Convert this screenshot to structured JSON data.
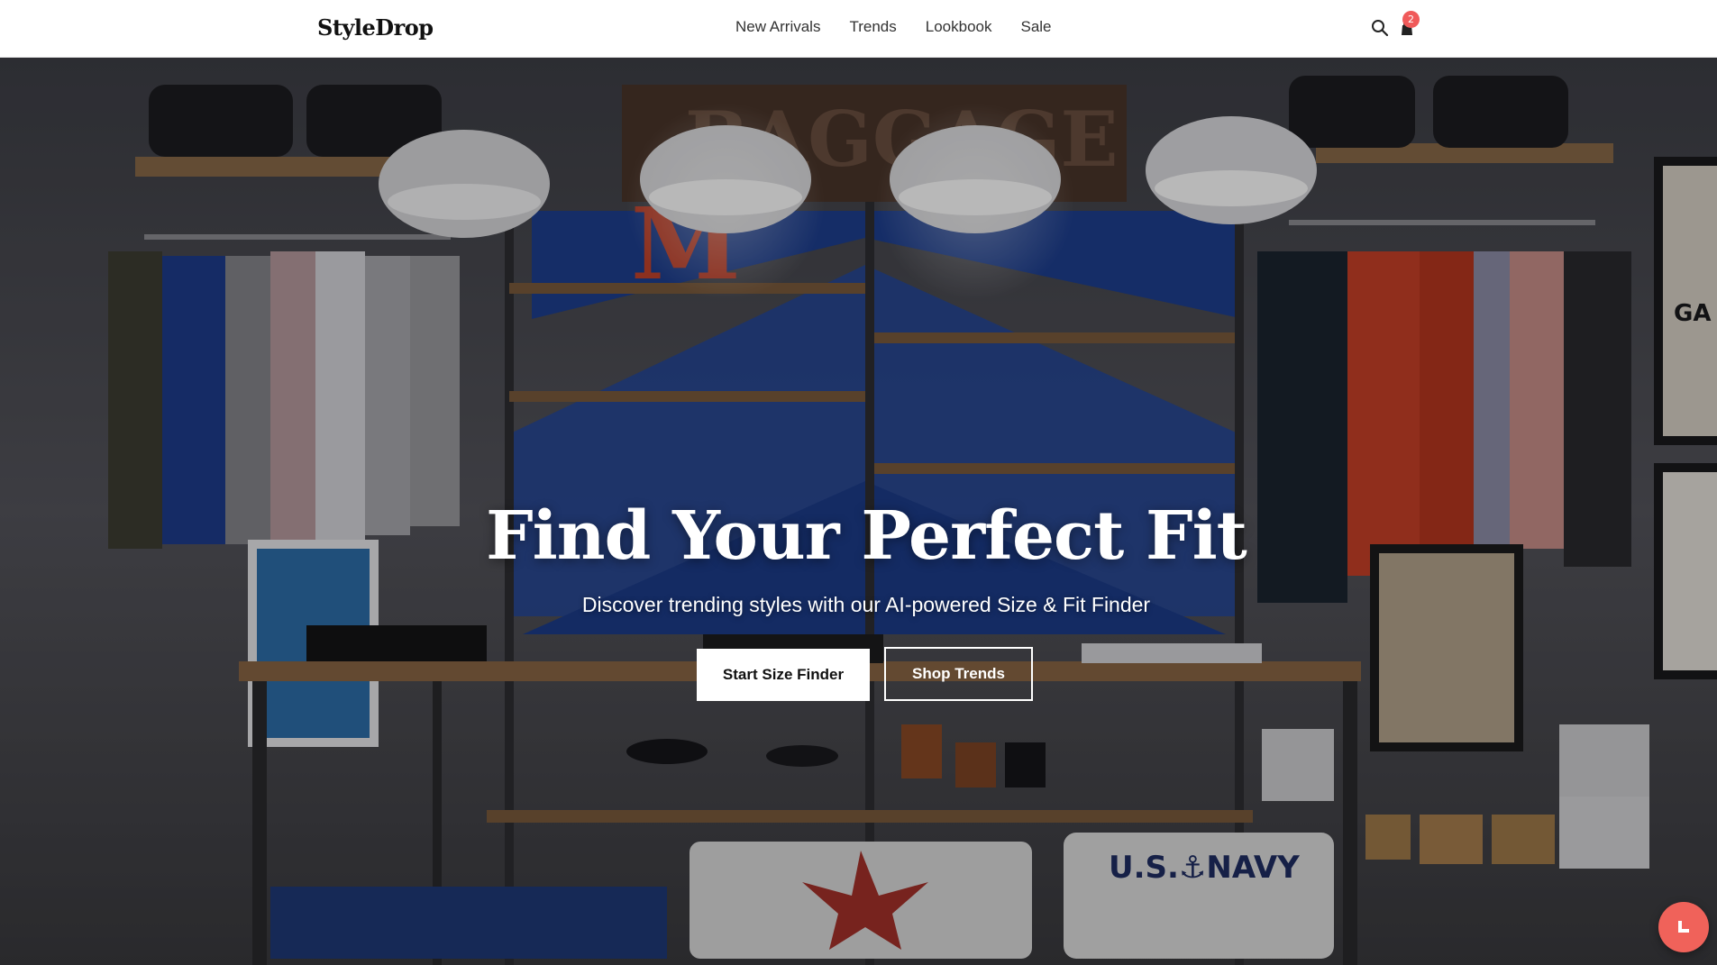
{
  "brand": {
    "logo": "StyleDrop"
  },
  "nav": {
    "items": [
      {
        "label": "New Arrivals"
      },
      {
        "label": "Trends"
      },
      {
        "label": "Lookbook"
      },
      {
        "label": "Sale"
      }
    ]
  },
  "header": {
    "search_icon": "search-icon",
    "cart_icon": "shopping-bag-icon",
    "cart_count": "2"
  },
  "hero": {
    "title": "Find Your Perfect Fit",
    "subtitle": "Discover trending styles with our AI-powered Size & Fit Finder",
    "primary_button": "Start Size Finder",
    "secondary_button": "Shop Trends",
    "background_image": "clothing-store-interior-photo",
    "sign_text": "BAGGAGE",
    "letter_sign": "M",
    "shirt_text": "U.S.⚓NAVY"
  },
  "fab": {
    "icon": "chat-icon"
  },
  "colors": {
    "accent": "#f0625a",
    "badge": "#f05a5a",
    "header_bg": "#ffffff",
    "text_dark": "#111111"
  }
}
